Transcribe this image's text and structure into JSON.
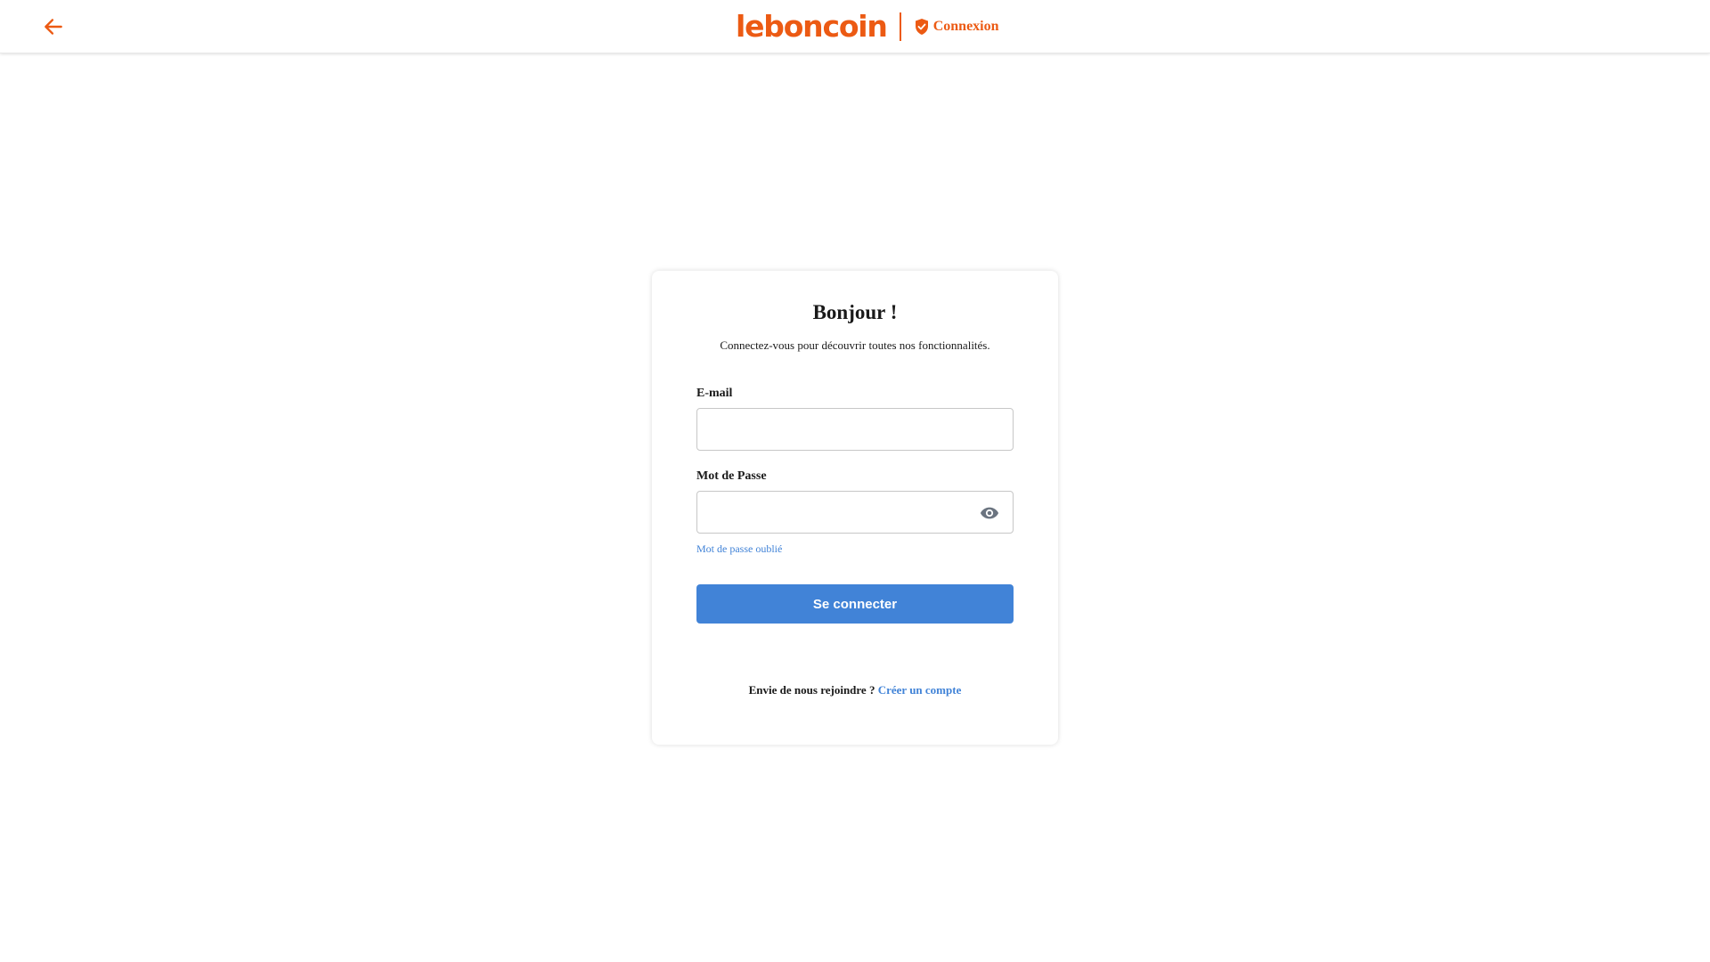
{
  "header": {
    "logo_text": "leboncoin",
    "secure_label": "Connexion",
    "icons": {
      "back": "arrow-left-icon",
      "secure": "shield-check-icon"
    }
  },
  "card": {
    "title": "Bonjour !",
    "subtitle": "Connectez-vous pour découvrir toutes nos fonctionnalités.",
    "email": {
      "label": "E-mail",
      "value": "",
      "placeholder": ""
    },
    "password": {
      "label": "Mot de Passe",
      "value": "",
      "placeholder": "",
      "toggle_icon": "eye-icon"
    },
    "forgot_link": "Mot de passe oublié",
    "submit_label": "Se connecter",
    "join_text": "Envie de nous rejoindre ?",
    "create_account_link": "Créer un compte"
  },
  "colors": {
    "brand": "#ec5a13",
    "link": "#4183d7",
    "primary_button": "#4183d7",
    "input_border": "#c7c7c7",
    "icon_gray": "#6b7480"
  }
}
